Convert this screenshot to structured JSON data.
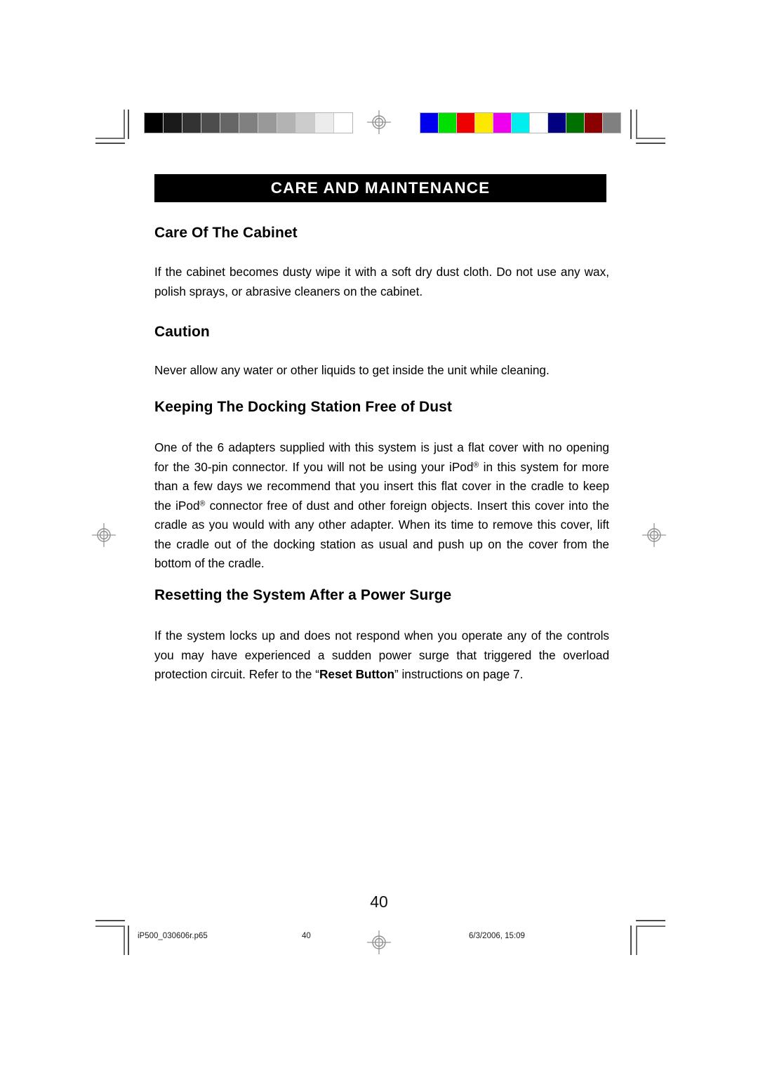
{
  "document": {
    "banner_title": "CARE AND MAINTENANCE",
    "page_number": "40"
  },
  "sections": [
    {
      "heading": "Care Of The Cabinet",
      "body": "If the cabinet becomes dusty wipe it with a soft dry dust cloth.  Do not use any wax, polish sprays, or abrasive cleaners on the cabinet."
    },
    {
      "heading": "Caution",
      "body": "Never allow any water or other liquids to get inside the unit while cleaning."
    },
    {
      "heading": "Keeping The Docking Station Free of Dust",
      "body_part_1": "One of the 6 adapters supplied with this system is just a flat cover with no opening for the 30-pin connector. If you will not be using your iPod",
      "reg_mark_1": "®",
      "body_part_2": " in this system for more than a few days we recommend that you insert this flat cover in the cradle to keep the iPod",
      "reg_mark_2": "®",
      "body_part_3": " connector free of dust and other foreign objects. Insert this cover into the cradle as you would with any other adapter. When its time to remove this cover, lift the cradle out of the docking station as usual and push up on the cover from the bottom of the cradle."
    },
    {
      "heading": "Resetting the System After a Power Surge",
      "body_part_1": "If the system locks up and does not respond when you operate any of the controls you may have experienced a sudden power surge that triggered the overload protection circuit.  Refer to the “",
      "bold_term": "Reset Button",
      "body_part_2": "” instructions on page 7."
    }
  ],
  "footer": {
    "file_name": "iP500_030606r.p65",
    "page_label": "40",
    "timestamp": "6/3/2006, 15:09"
  },
  "calibration": {
    "grayscale_label": "grayscale-step-wedge",
    "grayscale_patches": [
      "#000000",
      "#1a1a1a",
      "#333333",
      "#4d4d4d",
      "#666666",
      "#808080",
      "#999999",
      "#b3b3b3",
      "#cccccc",
      "#ececec",
      "#ffffff"
    ],
    "color_label": "color-control-bar",
    "color_patches": [
      "#0000ee",
      "#00e000",
      "#ee0000",
      "#ffe800",
      "#ef00ef",
      "#00eeee",
      "#ffffff",
      "#000080",
      "#007000",
      "#8b0000",
      "#808080"
    ]
  },
  "marks": {
    "registration_target": "registration-target",
    "crop_mark": "crop-mark"
  }
}
